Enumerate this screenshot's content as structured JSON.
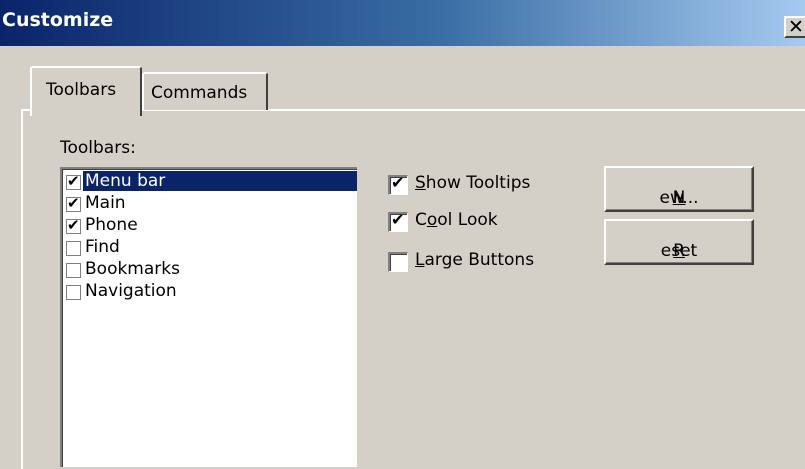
{
  "window": {
    "title": "Customize",
    "close_label": "✕"
  },
  "tabs": [
    {
      "label": "Toolbars",
      "selected": true
    },
    {
      "label": "Commands",
      "selected": false
    }
  ],
  "toolbars_panel": {
    "list_label": "Toolbars:",
    "items": [
      {
        "label": "Menu bar",
        "checked": true,
        "selected": true
      },
      {
        "label": "Main",
        "checked": true,
        "selected": false
      },
      {
        "label": "Phone",
        "checked": true,
        "selected": false
      },
      {
        "label": "Find",
        "checked": false,
        "selected": false
      },
      {
        "label": "Bookmarks",
        "checked": false,
        "selected": false
      },
      {
        "label": "Navigation",
        "checked": false,
        "selected": false
      }
    ],
    "options": {
      "show_tooltips": {
        "accel": "S",
        "rest": "how Tooltips",
        "checked": true
      },
      "cool_look": {
        "pre": "C",
        "accel": "o",
        "rest": "ol Look",
        "checked": true
      },
      "large_buttons": {
        "accel": "L",
        "rest": "arge Buttons",
        "checked": false
      }
    },
    "buttons": {
      "new": {
        "accel": "N",
        "rest": "ew..."
      },
      "reset": {
        "accel": "R",
        "rest": "eset"
      }
    }
  },
  "colors": {
    "titlebar_start": "#0a246a",
    "titlebar_end": "#a6caf0",
    "selection": "#0a246a",
    "face": "#d4d0c8"
  }
}
